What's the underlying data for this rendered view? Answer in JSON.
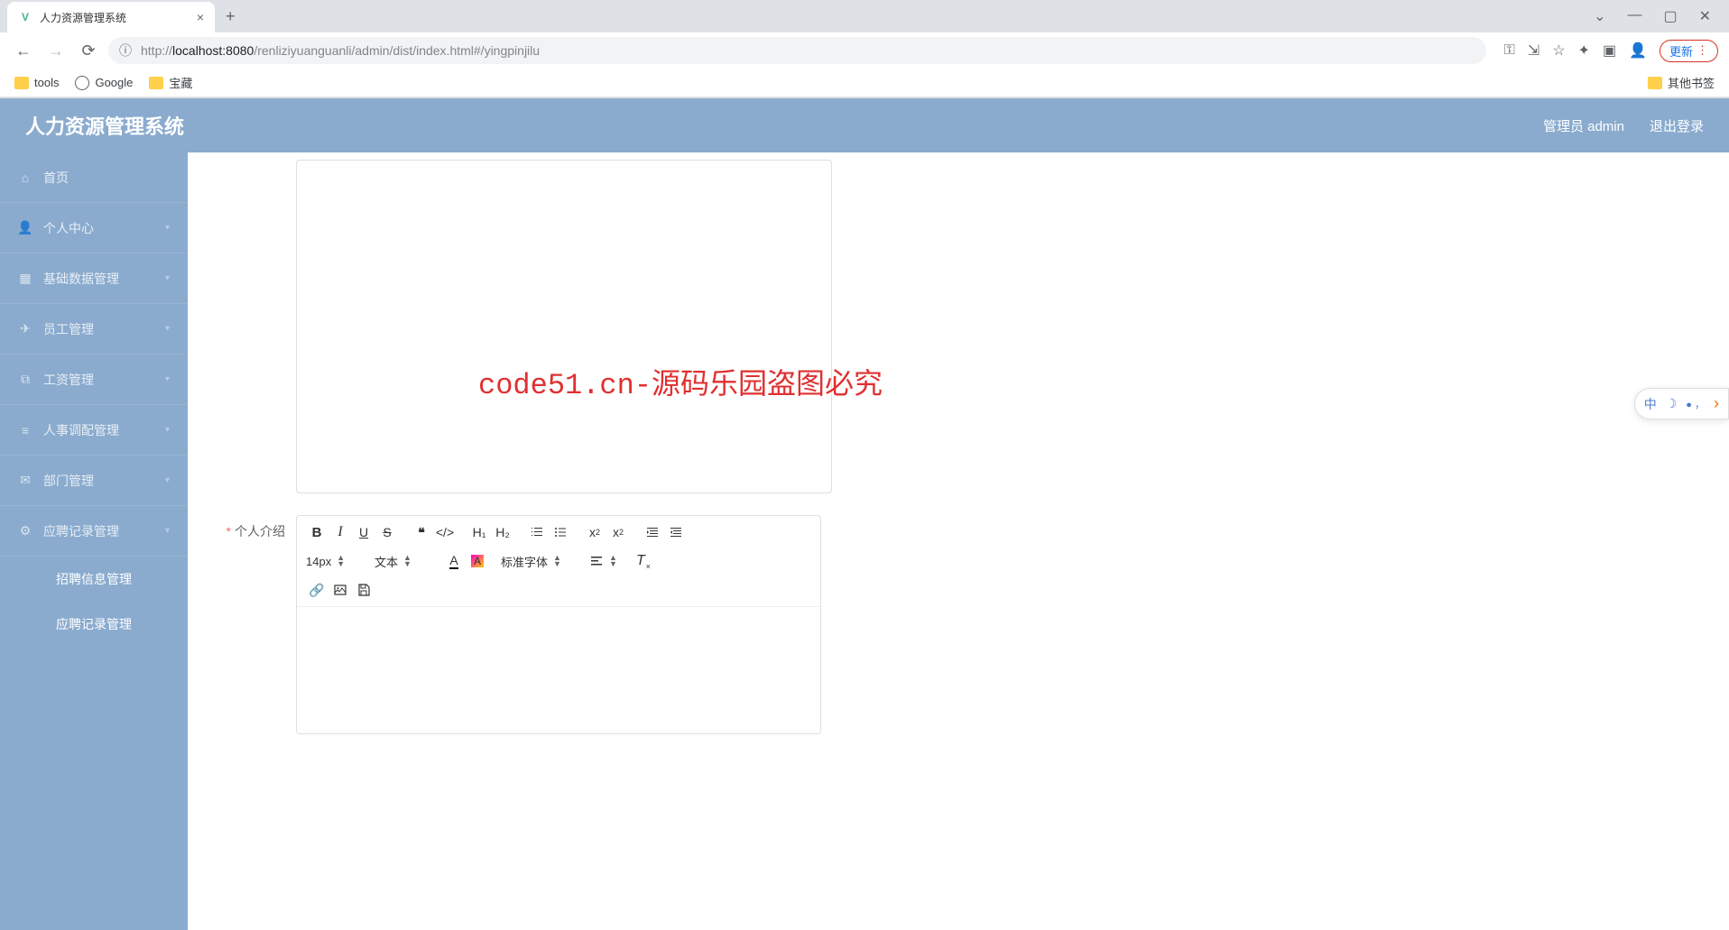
{
  "browser": {
    "tab_title": "人力资源管理系统",
    "url_host": "localhost:8080",
    "url_path": "/renliziyuanguanli/admin/dist/index.html#/yingpinjilu",
    "update_label": "更新",
    "bookmarks": {
      "tools": "tools",
      "google": "Google",
      "treasure": "宝藏",
      "other": "其他书签"
    }
  },
  "header": {
    "app_title": "人力资源管理系统",
    "user_label": "管理员 admin",
    "logout_label": "退出登录"
  },
  "sidebar": {
    "items": [
      {
        "label": "首页"
      },
      {
        "label": "个人中心"
      },
      {
        "label": "基础数据管理"
      },
      {
        "label": "员工管理"
      },
      {
        "label": "工资管理"
      },
      {
        "label": "人事调配管理"
      },
      {
        "label": "部门管理"
      },
      {
        "label": "应聘记录管理"
      }
    ],
    "submenu": [
      {
        "label": "招聘信息管理"
      },
      {
        "label": "应聘记录管理"
      }
    ]
  },
  "form": {
    "intro_label": "个人介绍"
  },
  "editor": {
    "font_size": "14px",
    "style_select": "文本",
    "font_family": "标准字体"
  },
  "watermark_text": "code51.cn-源码乐园盗图必究",
  "ime_widget": {
    "lang": "中"
  }
}
